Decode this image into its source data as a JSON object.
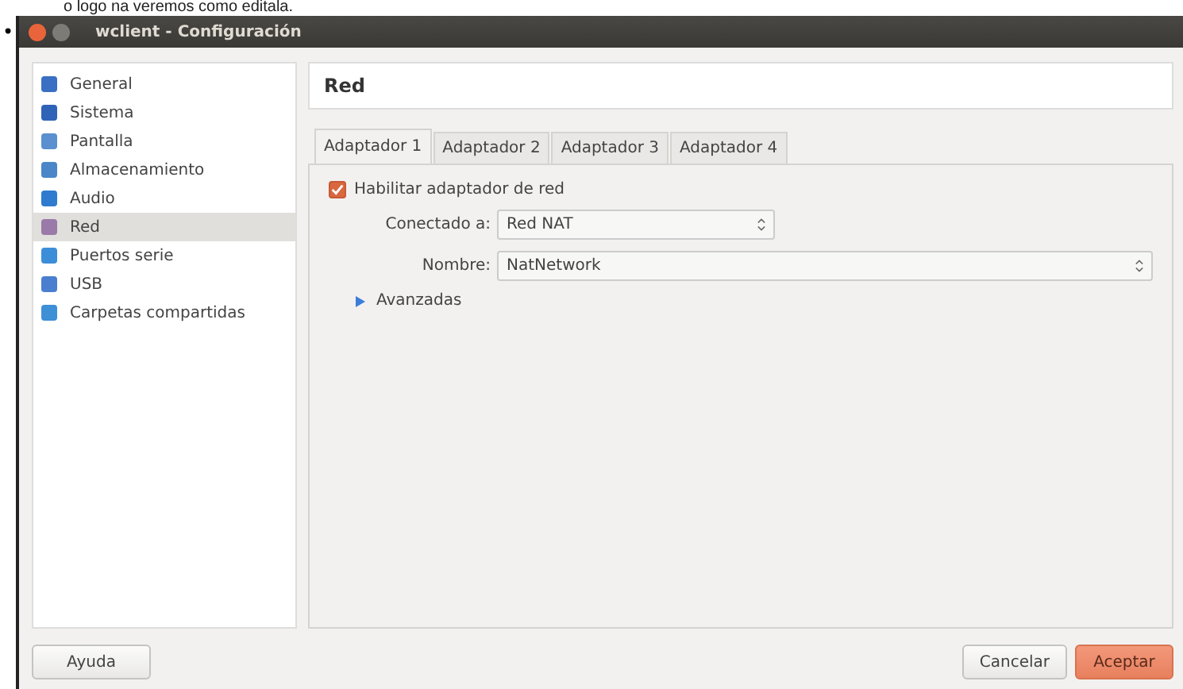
{
  "page_text": "o logo na veremos como editala.",
  "bullet": "•",
  "window": {
    "title": "wclient - Configuración"
  },
  "sidebar": {
    "items": [
      {
        "label": "General",
        "selected": false
      },
      {
        "label": "Sistema",
        "selected": false
      },
      {
        "label": "Pantalla",
        "selected": false
      },
      {
        "label": "Almacenamiento",
        "selected": false
      },
      {
        "label": "Audio",
        "selected": false
      },
      {
        "label": "Red",
        "selected": true
      },
      {
        "label": "Puertos serie",
        "selected": false
      },
      {
        "label": "USB",
        "selected": false
      },
      {
        "label": "Carpetas compartidas",
        "selected": false
      }
    ]
  },
  "section_title": "Red",
  "tabs": [
    {
      "label": "Adaptador 1",
      "selected": true
    },
    {
      "label": "Adaptador 2",
      "selected": false
    },
    {
      "label": "Adaptador 3",
      "selected": false
    },
    {
      "label": "Adaptador 4",
      "selected": false
    }
  ],
  "enable_adapter": {
    "label": "Habilitar adaptador de red",
    "checked": true
  },
  "attached_to": {
    "label": "Conectado a:",
    "value": "Red NAT"
  },
  "name": {
    "label": "Nombre:",
    "value": "NatNetwork"
  },
  "advanced": {
    "label": "Avanzadas",
    "expanded": false
  },
  "buttons": {
    "help": "Ayuda",
    "cancel": "Cancelar",
    "accept": "Aceptar"
  }
}
